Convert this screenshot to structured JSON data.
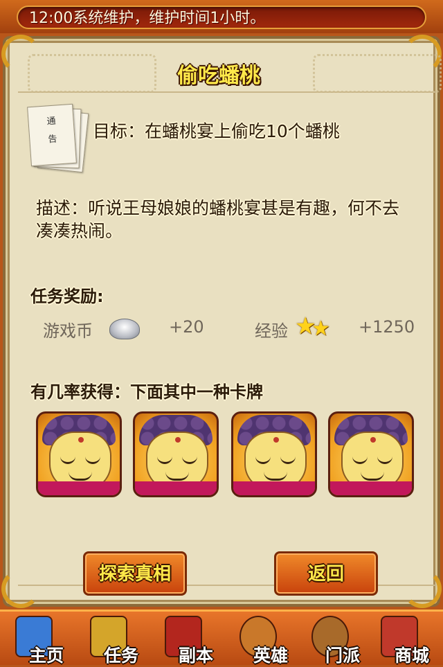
{
  "marquee": {
    "text": "12:00系统维护，维护时间1小时。"
  },
  "quest": {
    "title": "偷吃蟠桃",
    "goal": "目标：在蟠桃宴上偷吃10个蟠桃",
    "description": "描述：听说王母娘娘的蟠桃宴甚是有趣，何不去凑凑热闹。",
    "scroll_text": "通 告"
  },
  "rewards": {
    "heading": "任务奖励:",
    "coin_label": "游戏币",
    "coin_value": "+20",
    "exp_label": "经验",
    "exp_value": "+1250",
    "coin_icon": "silver-ingot-icon",
    "exp_icon": "two-stars-icon"
  },
  "cards": {
    "heading": "有几率获得：下面其中一种卡牌",
    "items": [
      {
        "icon": "buddha-card"
      },
      {
        "icon": "buddha-card"
      },
      {
        "icon": "buddha-card"
      },
      {
        "icon": "buddha-card"
      }
    ]
  },
  "buttons": {
    "explore": "探索真相",
    "back": "返回"
  },
  "nav": {
    "items": [
      {
        "label": "主页",
        "icon": "home-icon",
        "color": "#3a7bd5"
      },
      {
        "label": "任务",
        "icon": "scroll-icon",
        "color": "#d4a52a"
      },
      {
        "label": "副本",
        "icon": "flag-icon",
        "color": "#b3261e"
      },
      {
        "label": "英雄",
        "icon": "monkey-king-icon",
        "color": "#c9782a"
      },
      {
        "label": "门派",
        "icon": "shield-icon",
        "color": "#a86a2a"
      },
      {
        "label": "商城",
        "icon": "treasure-chest-icon",
        "color": "#c0392b"
      }
    ]
  }
}
